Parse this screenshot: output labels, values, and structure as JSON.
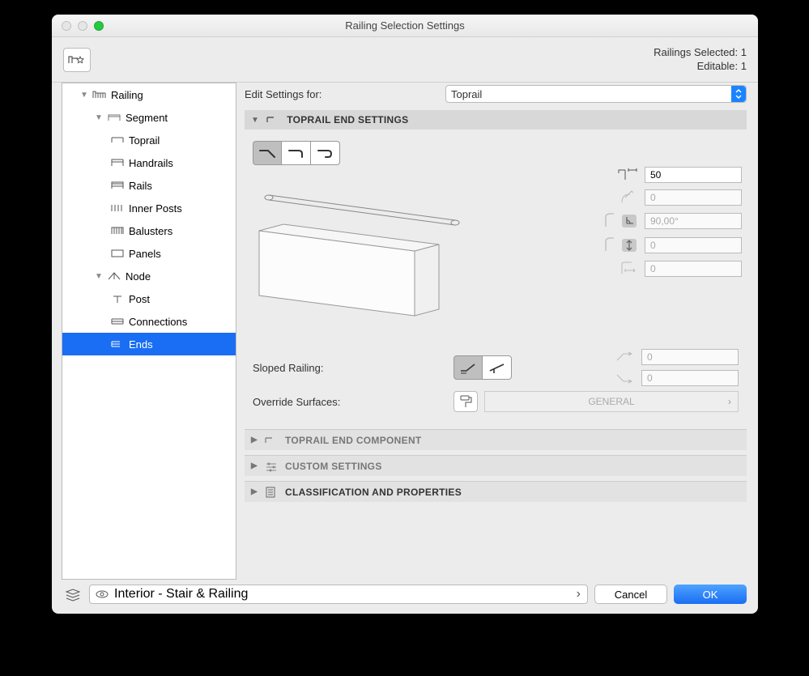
{
  "window": {
    "title": "Railing Selection Settings"
  },
  "status": {
    "selected_label": "Railings Selected: 1",
    "editable_label": "Editable: 1"
  },
  "sidebar": {
    "root": "Railing",
    "segment": "Segment",
    "segment_children": [
      "Toprail",
      "Handrails",
      "Rails",
      "Inner Posts",
      "Balusters",
      "Panels"
    ],
    "node": "Node",
    "node_children": [
      "Post",
      "Connections",
      "Ends"
    ]
  },
  "edit_for": {
    "label": "Edit Settings for:",
    "value": "Toprail"
  },
  "sections": {
    "end_settings": "TOPRAIL END SETTINGS",
    "component": "TOPRAIL END COMPONENT",
    "custom": "CUSTOM SETTINGS",
    "classification": "CLASSIFICATION AND PROPERTIES"
  },
  "params": {
    "extension": "50",
    "radius": "0",
    "angle": "90,00°",
    "offset": "0",
    "horiz": "0"
  },
  "sloped": {
    "label": "Sloped Railing:",
    "top": "0",
    "bottom": "0"
  },
  "override": {
    "label": "Override Surfaces:",
    "value": "GENERAL"
  },
  "layer": {
    "value": "Interior - Stair & Railing"
  },
  "buttons": {
    "cancel": "Cancel",
    "ok": "OK"
  }
}
